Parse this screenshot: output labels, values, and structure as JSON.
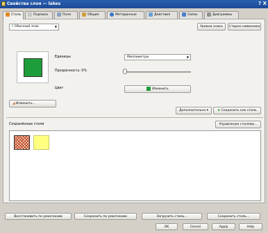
{
  "window": {
    "title": "Свойства слоя — lakes",
    "controls": "? X"
  },
  "tabs": [
    {
      "label": "Стиль",
      "icon": "brush-icon",
      "color": "#e08a20"
    },
    {
      "label": "Подписи",
      "icon": "label-icon",
      "color": "#c8c8c8"
    },
    {
      "label": "Поля",
      "icon": "table-icon",
      "color": "#8aa0c0"
    },
    {
      "label": "Общие",
      "icon": "wrench-icon",
      "color": "#d0a040"
    },
    {
      "label": "Метаданные",
      "icon": "info-icon",
      "color": "#3a78c8"
    },
    {
      "label": "Действия",
      "icon": "action-icon",
      "color": "#6aa0d8"
    },
    {
      "label": "Связи",
      "icon": "join-icon",
      "color": "#4a80c8"
    },
    {
      "label": "Диаграммы",
      "icon": "diagram-icon",
      "color": "#909090"
    }
  ],
  "style": {
    "renderer": "Обычный знак",
    "symbol_levels": "Уровни знака",
    "old_symbology": "Старая символика",
    "units_label": "Единицы",
    "units_value": "Миллиметры",
    "transparency_label": "Прозрачность: 0%",
    "transparency_value": 0,
    "color_label": "Цвет",
    "change_color": "Изменить",
    "change": "Изменить...",
    "advanced": "Дополнительно",
    "save_as_style": "Сохранить как стиль",
    "saved_styles_label": "Сохранённые стили",
    "manage_styles": "Управление стилями...",
    "symbol_color": "#1e9e3a",
    "saved_styles": [
      {
        "name": "hatch-style",
        "color": "#f0c8a0"
      },
      {
        "name": "yellow-style",
        "color": "#ffff80"
      }
    ]
  },
  "footer": {
    "restore_default": "Восстановить по умолчанию",
    "save_default": "Сохранить по умолчанию",
    "load_style": "Загрузить стиль...",
    "save_style": "Сохранить стиль...",
    "ok": "OK",
    "cancel": "Cancel",
    "apply": "Apply",
    "help": "Help"
  }
}
